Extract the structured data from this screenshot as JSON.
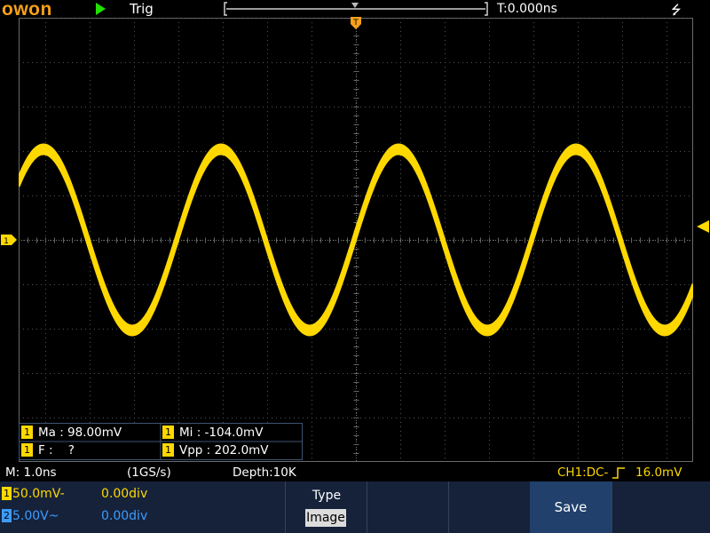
{
  "top": {
    "logo": "owon",
    "trigger_status": "Trig",
    "time_offset": "T:0.000ns",
    "icons": {
      "run": "run-icon",
      "usb": "usb-icon",
      "trigger_marker": "trigger-position-marker"
    }
  },
  "markers": {
    "ch1": "1",
    "trigger": "T"
  },
  "measurements": [
    {
      "ch": "1",
      "label": "Ma : 98.00mV"
    },
    {
      "ch": "1",
      "label": "Mi : -104.0mV"
    },
    {
      "ch": "1",
      "label": "F :    ?"
    },
    {
      "ch": "1",
      "label": "Vpp : 202.0mV"
    }
  ],
  "status": {
    "timebase": "M: 1.0ns",
    "sample_rate": "(1GS/s)",
    "depth": "Depth:10K",
    "trigger_info": "CH1:DC-",
    "trigger_level": "16.0mV",
    "edge_icon": "rising-edge-icon"
  },
  "channels": [
    {
      "badge": "1",
      "scale": "50.0mV",
      "coupling": "-",
      "offset": "0.00div",
      "color": "#ffd800"
    },
    {
      "badge": "2",
      "scale": "5.00V",
      "coupling": "~",
      "offset": "0.00div",
      "color": "#3d9cff"
    }
  ],
  "menu": {
    "type_label": "Type",
    "type_value": "Image",
    "save_label": "Save"
  },
  "waveform": {
    "color": "#ffd800",
    "amplitude_div": 2.0,
    "period_div": 2.0
  }
}
